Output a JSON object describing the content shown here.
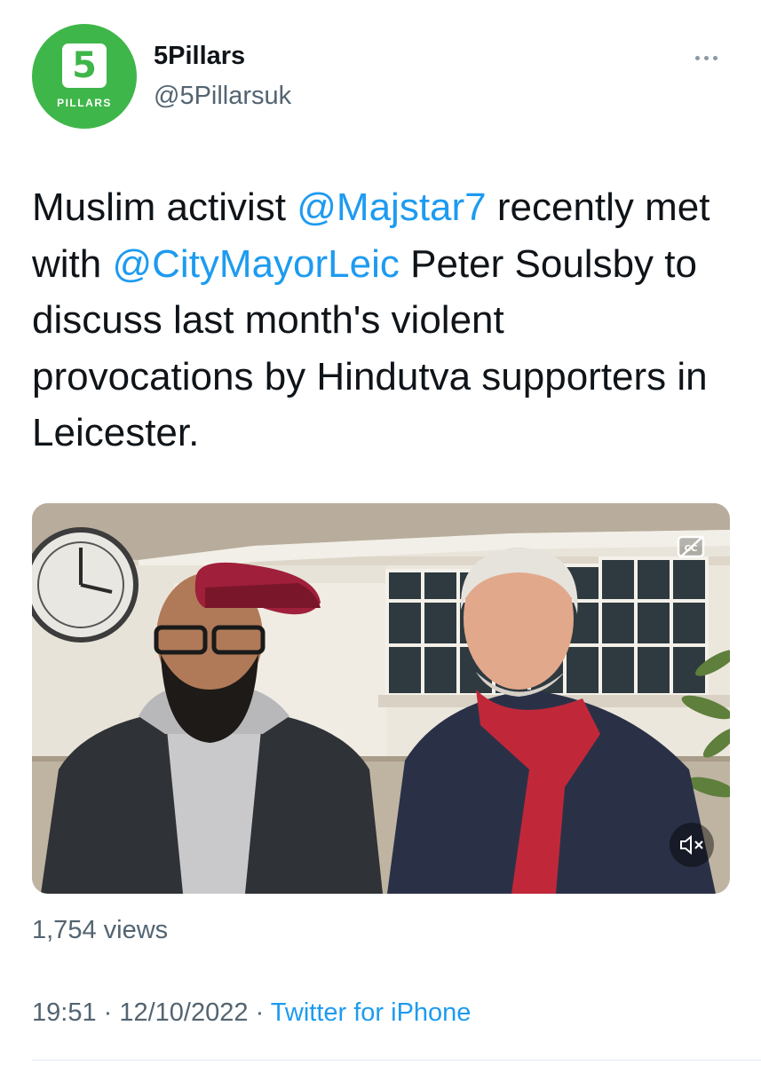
{
  "account": {
    "avatar_digit": "5",
    "avatar_text": "PILLARS",
    "display_name": "5Pillars",
    "handle": "@5Pillarsuk",
    "brand_color": "#3fb649"
  },
  "header": {
    "more_icon": "more-horizontal-icon"
  },
  "tweet": {
    "segments": [
      {
        "text": "Muslim activist ",
        "type": "text"
      },
      {
        "text": "@Majstar7",
        "type": "mention"
      },
      {
        "text": " recently met with ",
        "type": "text"
      },
      {
        "text": "@CityMayorLeic",
        "type": "mention"
      },
      {
        "text": " Peter Soulsby to discuss last month's violent provocations by Hindutva supporters in Leicester.",
        "type": "text"
      }
    ],
    "mention_color": "#1d9bf0"
  },
  "media": {
    "type": "video",
    "captions_icon": "closed-captions-icon",
    "mute_icon": "speaker-muted-icon"
  },
  "stats": {
    "views": "1,754 views"
  },
  "meta": {
    "time": "19:51",
    "separator": " · ",
    "date": "12/10/2022",
    "source": "Twitter for iPhone"
  }
}
